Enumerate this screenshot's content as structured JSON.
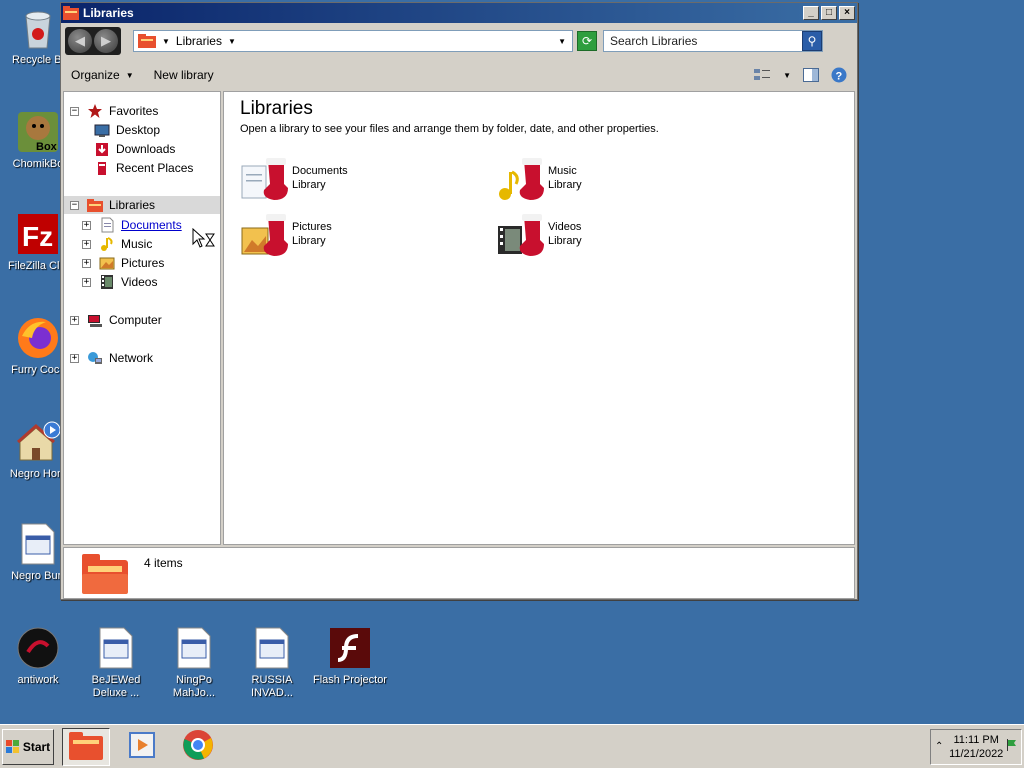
{
  "desktop": {
    "icons": [
      {
        "label": "Recycle Bi"
      },
      {
        "label": "ChomikBo"
      },
      {
        "label": "FileZilla Clie"
      },
      {
        "label": "Furry Cock"
      },
      {
        "label": "Negro Hom"
      },
      {
        "label": "Negro Burr"
      },
      {
        "label": "antiwork"
      },
      {
        "label": "BeJEWed Deluxe ..."
      },
      {
        "label": "NingPo MahJo..."
      },
      {
        "label": "RUSSIA INVAD..."
      },
      {
        "label": "Flash Projector"
      }
    ]
  },
  "window": {
    "title": "Libraries",
    "controls": {
      "minimize": "_",
      "maximize": "□",
      "close": "×"
    },
    "address": {
      "crumb": "Libraries",
      "search_placeholder": "Search Libraries"
    },
    "toolbar": {
      "organize": "Organize",
      "new_library": "New library"
    },
    "nav": {
      "favorites": "Favorites",
      "desktop": "Desktop",
      "downloads": "Downloads",
      "recent_places": "Recent Places",
      "libraries": "Libraries",
      "documents": "Documents",
      "music": "Music",
      "pictures": "Pictures",
      "videos": "Videos",
      "computer": "Computer",
      "network": "Network"
    },
    "content": {
      "heading": "Libraries",
      "subtitle": "Open a library to see your files and arrange them by folder, date, and other properties.",
      "items": [
        {
          "name": "Documents",
          "type": "Library"
        },
        {
          "name": "Music",
          "type": "Library"
        },
        {
          "name": "Pictures",
          "type": "Library"
        },
        {
          "name": "Videos",
          "type": "Library"
        }
      ]
    },
    "details": {
      "count": "4 items"
    }
  },
  "taskbar": {
    "start": "Start",
    "time": "11:11 PM",
    "date": "11/21/2022"
  },
  "colors": {
    "desktop": "#3a6ea5",
    "titlebar": "#0a246a",
    "chrome": "#d4d0c8",
    "stocking_red": "#c8102e"
  }
}
